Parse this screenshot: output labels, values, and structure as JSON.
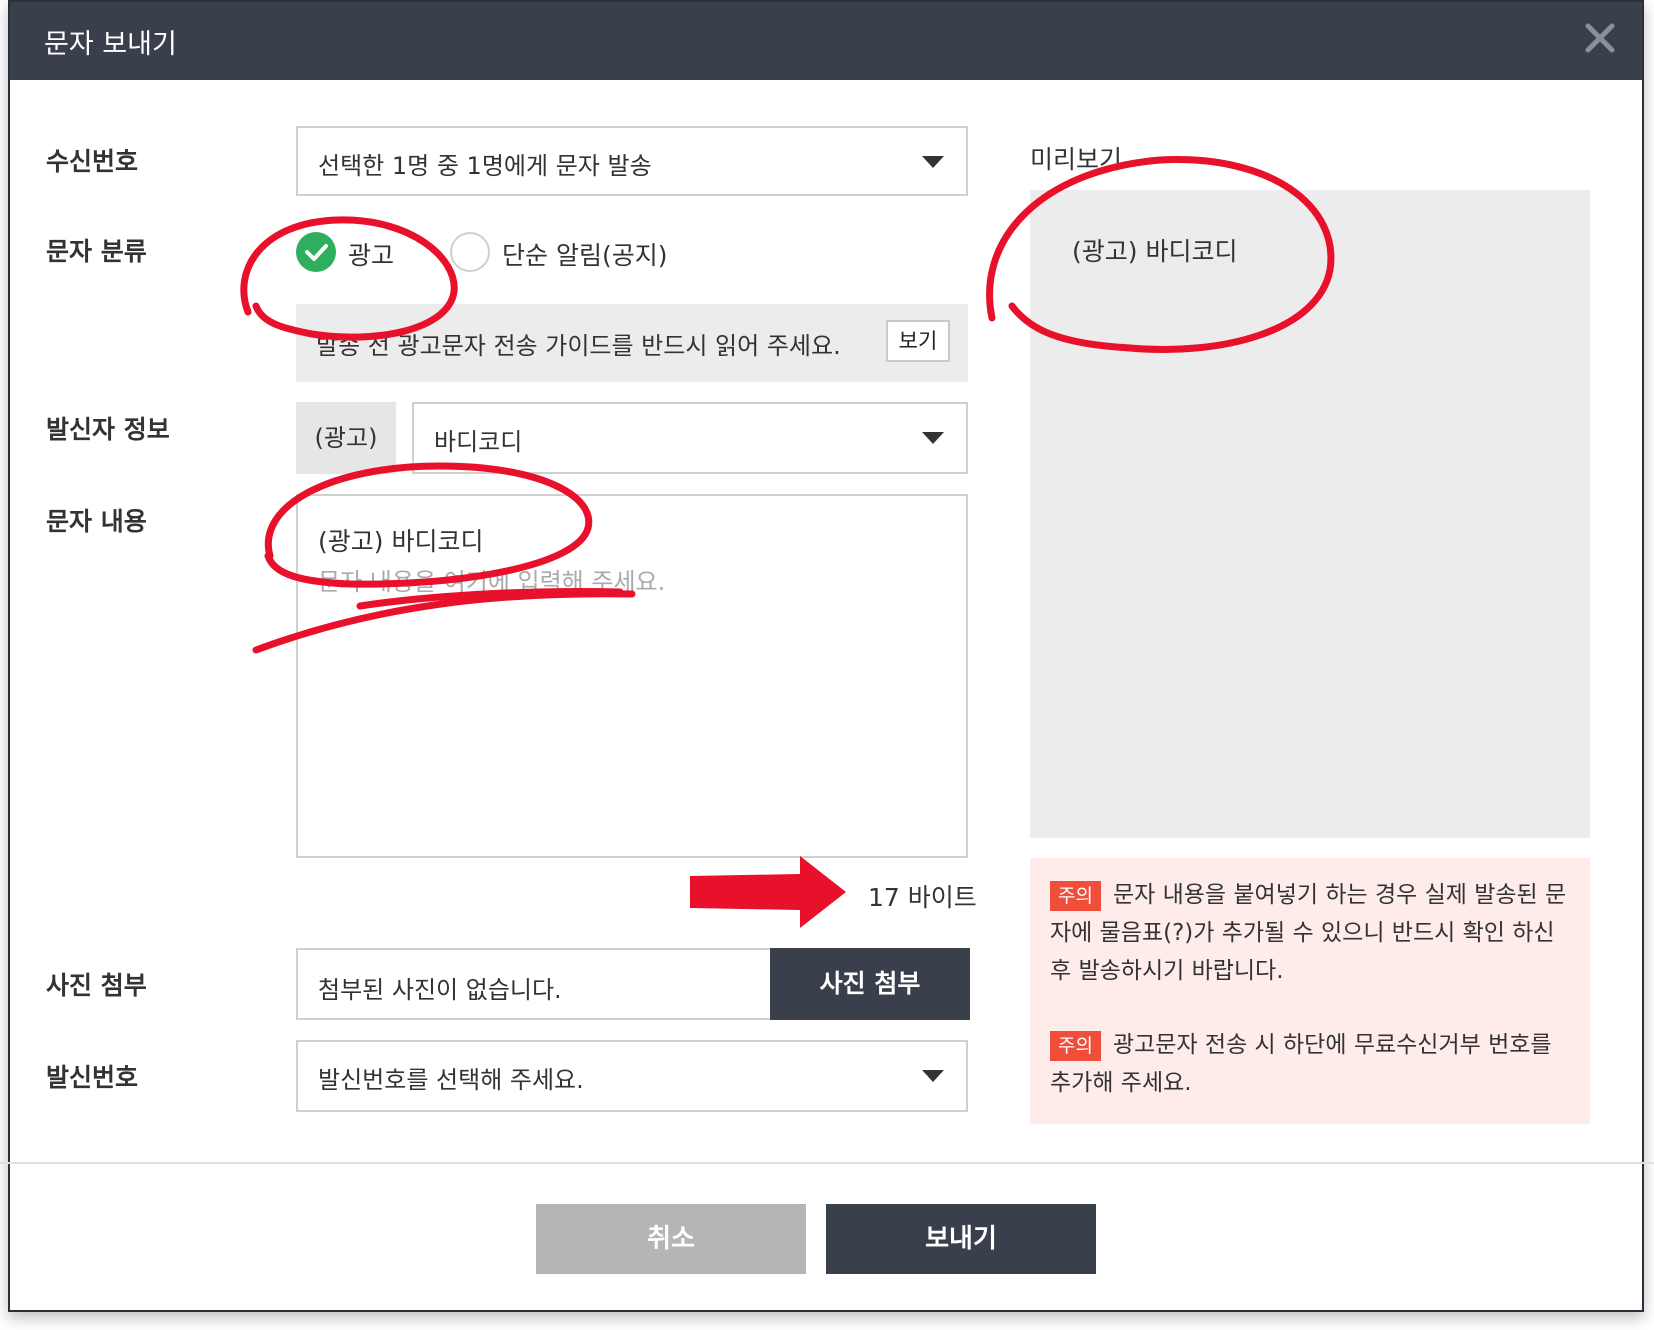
{
  "dialog": {
    "title": "문자 보내기",
    "close_icon": "close-icon"
  },
  "form": {
    "recipient": {
      "label": "수신번호",
      "value": "선택한 1명 중 1명에게 문자 발송"
    },
    "category": {
      "label": "문자 분류",
      "options": [
        {
          "label": "광고",
          "selected": true
        },
        {
          "label": "단순 알림(공지)",
          "selected": false
        }
      ],
      "guide_text": "발송 전 광고문자 전송 가이드를 반드시 읽어 주세요.",
      "guide_button": "보기"
    },
    "sender_info": {
      "label": "발신자 정보",
      "prefix": "(광고)",
      "value": "바디코디"
    },
    "message": {
      "label": "문자 내용",
      "value": "(광고) 바디코디",
      "placeholder": "문자 내용을 여기에 입력해 주세요.",
      "byte_count": "17 바이트"
    },
    "photo": {
      "label": "사진 첨부",
      "status": "첨부된 사진이 없습니다.",
      "button": "사진 첨부"
    },
    "sender_number": {
      "label": "발신번호",
      "value": "발신번호를 선택해 주세요."
    }
  },
  "preview": {
    "title": "미리보기",
    "text": "(광고) 바디코디"
  },
  "notices": [
    {
      "badge": "주의",
      "text": "문자 내용을 붙여넣기 하는 경우 실제 발송된 문자에 물음표(?)가 추가될 수 있으니 반드시 확인 하신 후 발송하시기 바랍니다."
    },
    {
      "badge": "주의",
      "text": "광고문자 전송 시 하단에 무료수신거부 번호를 추가해 주세요."
    }
  ],
  "footer": {
    "cancel": "취소",
    "send": "보내기"
  },
  "colors": {
    "header": "#3a3f4c",
    "accent_green": "#2fae5e",
    "badge_red": "#f04e3a",
    "annotation_red": "#e8102a",
    "notice_bg": "#fdecea"
  }
}
